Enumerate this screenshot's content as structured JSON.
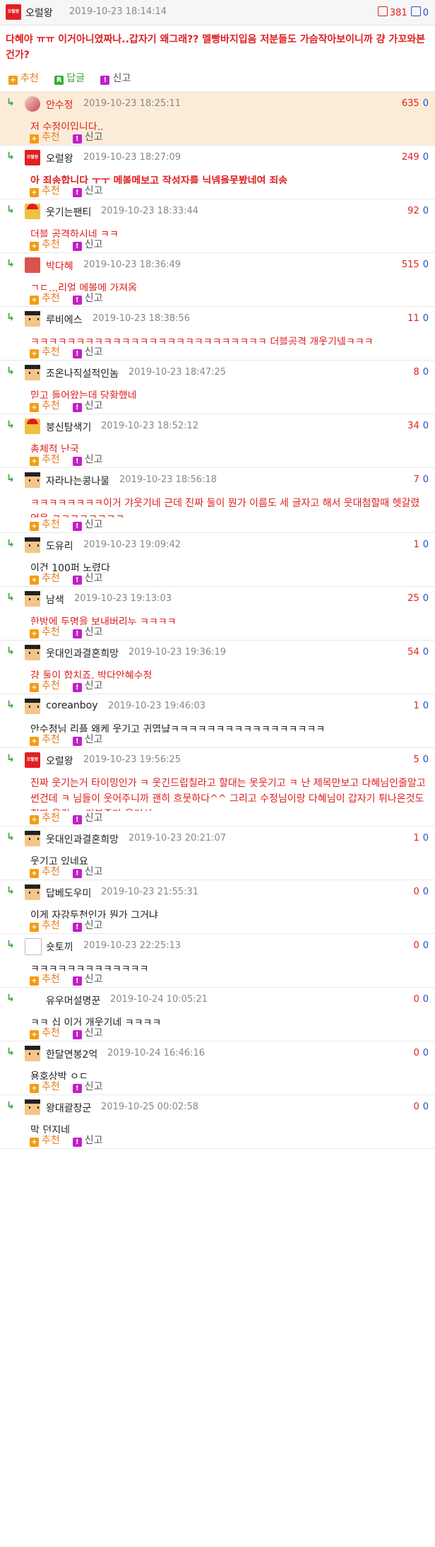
{
  "post": {
    "author": "오럴왕",
    "avatar_text": "오럴왕",
    "date": "2019-10-23 18:14:14",
    "up": "381",
    "down": "0",
    "text": "다혜야 ㅠㅠ 이거아니였짜나..갑자기 왜그래?? 멜빵바지입음 저분들도 가슴작아보이니까 걍 가꼬와본건가?",
    "recommend_label": "추천",
    "reply_label": "답글",
    "report_label": "신고"
  },
  "comments": [
    {
      "author": "안수정",
      "date": "2019-10-23 18:25:11",
      "up": "635",
      "down": "0",
      "text": "저 수정이입니다..",
      "avatar": "photo",
      "highlight": true,
      "nick_red": true,
      "text_style": "red"
    },
    {
      "author": "오럴왕",
      "date": "2019-10-23 18:27:09",
      "up": "249",
      "down": "0",
      "text": "아 죄송합니다 ㅜㅜ 메볼메보고 작성자를 닉넴을못봤네여 죄송",
      "avatar": "logo",
      "avatar_text": "오럴왕",
      "text_style": "red-bold"
    },
    {
      "author": "웃기는팬티",
      "date": "2019-10-23 18:33:44",
      "up": "92",
      "down": "0",
      "text": "더블 공격하시네 ㅋㅋ",
      "avatar": "redhat",
      "text_style": "red"
    },
    {
      "author": "박다혜",
      "date": "2019-10-23 18:36:49",
      "up": "515",
      "down": "0",
      "text": "ㄱㄷ...리얼 메볼메 가져옴",
      "avatar": "red",
      "nick_red": true,
      "text_style": "red"
    },
    {
      "author": "루비에스",
      "date": "2019-10-23 18:38:56",
      "up": "11",
      "down": "0",
      "text": "ㅋㅋㅋㅋㅋㅋㅋㅋㅋㅋㅋㅋㅋㅋㅋㅋㅋㅋㅋㅋㅋㅋㅋㅋㅋㅋ 더블공격 개웃기넼ㅋㅋㅋ",
      "avatar": "pix",
      "text_style": "red"
    },
    {
      "author": "조온나직설적인놈",
      "date": "2019-10-23 18:47:25",
      "up": "8",
      "down": "0",
      "text": "믿고 들어왔는데 당황했네",
      "avatar": "pix",
      "text_style": "red"
    },
    {
      "author": "붕신탐색기",
      "date": "2019-10-23 18:52:12",
      "up": "34",
      "down": "0",
      "text": "총체적 난국",
      "avatar": "redhat",
      "text_style": "red"
    },
    {
      "author": "자라나는콩나물",
      "date": "2019-10-23 18:56:18",
      "up": "7",
      "down": "0",
      "text": "ㅋㅋㅋㅋㅋㅋㅋㅋ이거 갸웃기네 근데 진짜 둘이 뭔가 이름도 세 글자고 해서 웃대첨할때 헷갈렸었음 ㅋㅋㅋㅋㅋㅋㅋㅋ",
      "avatar": "pix",
      "text_style": "red"
    },
    {
      "author": "도유리",
      "date": "2019-10-23 19:09:42",
      "up": "1",
      "down": "0",
      "text": "이건 100퍼 노렸다",
      "avatar": "pix",
      "text_style": "black"
    },
    {
      "author": "남색",
      "date": "2019-10-23 19:13:03",
      "up": "25",
      "down": "0",
      "text": "한방에 두명을 보내버리누 ㅋㅋㅋㅋ",
      "avatar": "pix",
      "text_style": "red"
    },
    {
      "author": "웃대인과결혼희망",
      "date": "2019-10-23 19:36:19",
      "up": "54",
      "down": "0",
      "text": "걍 둘이 합치죠, 박다안혜수정",
      "avatar": "pix",
      "text_style": "red"
    },
    {
      "author": "coreanboy",
      "date": "2019-10-23 19:46:03",
      "up": "1",
      "down": "0",
      "text": "안수정님 리플 왜케 웃기고 귀엽냨ㅋㅋㅋㅋㅋㅋㅋㅋㅋㅋㅋㅋㅋㅋㅋㅋㅋ",
      "avatar": "pix",
      "text_style": "black"
    },
    {
      "author": "오럴왕",
      "date": "2019-10-23 19:56:25",
      "up": "5",
      "down": "0",
      "text": "진짜 웃기는거 타이밍인가 ㅋ 웃긴드립칠라고 할대는 못웃기고 ㅋ 난 제목만보고 다혜님인줄알고 썬건데 ㅋ 님들이 웃어주니까 괜히 흐뭇하다^^ 그리고 수정님이랑 다혜님이 갑자기 튀나온것도 진짜 웃김 ㅋ 기분좋다 웃겨서",
      "avatar": "logo",
      "avatar_text": "오럴왕",
      "text_style": "red"
    },
    {
      "author": "웃대인과결혼희망",
      "date": "2019-10-23 20:21:07",
      "up": "1",
      "down": "0",
      "text": "웃기고 있네요",
      "avatar": "pix",
      "text_style": "black"
    },
    {
      "author": "답베도우미",
      "date": "2019-10-23 21:55:31",
      "up": "0",
      "down": "0",
      "text": "이게 자강두천인가 뭔가 그거냐",
      "avatar": "pix",
      "text_style": "black"
    },
    {
      "author": "숏토끼",
      "date": "2019-10-23 22:25:13",
      "up": "0",
      "down": "0",
      "text": "ㅋㅋㅋㅋㅋㅋㅋㅋㅋㅋㅋㅋㅋ",
      "avatar": "bunny",
      "text_style": "black"
    },
    {
      "author": "유우머설명꾼",
      "date": "2019-10-24 10:05:21",
      "up": "0",
      "down": "0",
      "text": "ㅋㅋ 십 이거 개웃기네 ㅋㅋㅋㅋ",
      "avatar": "blank",
      "text_style": "black"
    },
    {
      "author": "한달연봉2억",
      "date": "2019-10-24 16:46:16",
      "up": "0",
      "down": "0",
      "text": "용호상박 ㅇㄷ",
      "avatar": "pix",
      "text_style": "black"
    },
    {
      "author": "왕대괄장군",
      "date": "2019-10-25 00:02:58",
      "up": "0",
      "down": "0",
      "text": "막 던지네",
      "avatar": "pix",
      "text_style": "black"
    }
  ],
  "labels": {
    "recommend": "추천",
    "report": "신고"
  }
}
